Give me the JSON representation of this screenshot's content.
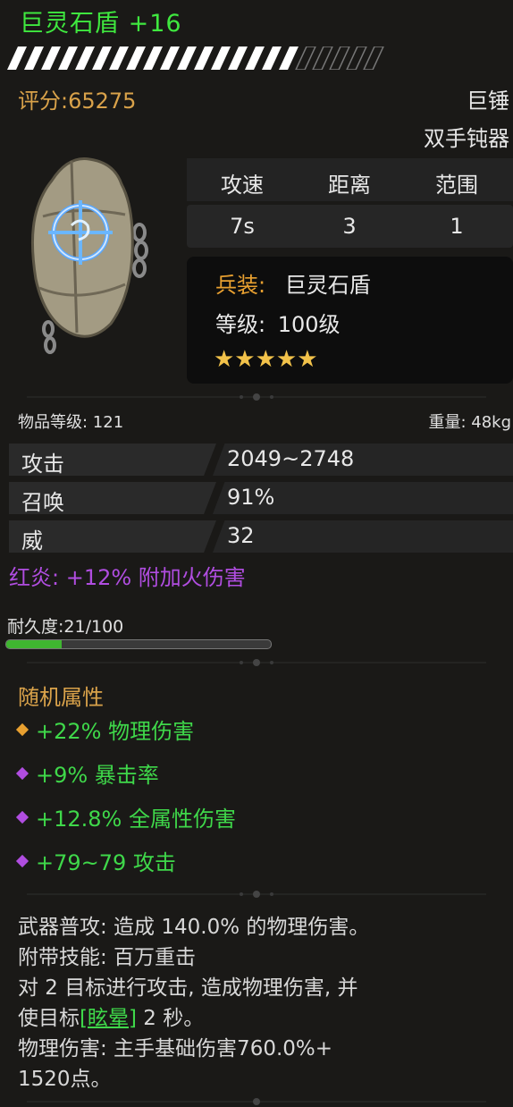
{
  "item": {
    "name": "巨灵石盾 +16",
    "score": "评分:65275",
    "weapon_type": "巨锤",
    "weapon_sub": "双手钝器"
  },
  "stats_table": {
    "headers": [
      "攻速",
      "距离",
      "范围"
    ],
    "values": [
      "7s",
      "3",
      "1"
    ]
  },
  "info": {
    "category_label": "兵装:",
    "category_value": "巨灵石盾",
    "level_label": "等级:",
    "level_value": "100级",
    "stars": 5,
    "stars_text": "★★★★★"
  },
  "meta": {
    "item_level": "物品等级: 121",
    "weight": "重量: 48kg"
  },
  "attributes": [
    {
      "label": "攻击",
      "value": "2049~2748"
    },
    {
      "label": "召唤",
      "value": "91%"
    },
    {
      "label": "威",
      "value": "32"
    }
  ],
  "special": "红炎: +12% 附加火伤害",
  "durability": {
    "label": "耐久度:21/100",
    "current": 21,
    "max": 100
  },
  "random": {
    "title": "随机属性",
    "items": [
      {
        "text": "+22% 物理伤害",
        "gem_color": "#e8a030"
      },
      {
        "text": "+9% 暴击率",
        "gem_color": "#b04de0"
      },
      {
        "text": "+12.8% 全属性伤害",
        "gem_color": "#b04de0"
      },
      {
        "text": "+79~79 攻击",
        "gem_color": "#b04de0"
      }
    ]
  },
  "description": {
    "line1": "武器普攻: 造成 140.0% 的物理伤害。",
    "line2": "附带技能: 百万重击",
    "line3": "对 2 目标进行攻击, 造成物理伤害, 并",
    "line4_pre": "使目标",
    "line4_link": "[眩晕]",
    "line4_post": " 2 秒。",
    "line5": "物理伤害: 主手基础伤害760.0%+",
    "line6": "1520点。"
  },
  "colors": {
    "title": "#3fe83f",
    "score": "#d9a24a",
    "special": "#b04de0",
    "random": "#3fd84a",
    "durability_fill": "#3fb630"
  }
}
